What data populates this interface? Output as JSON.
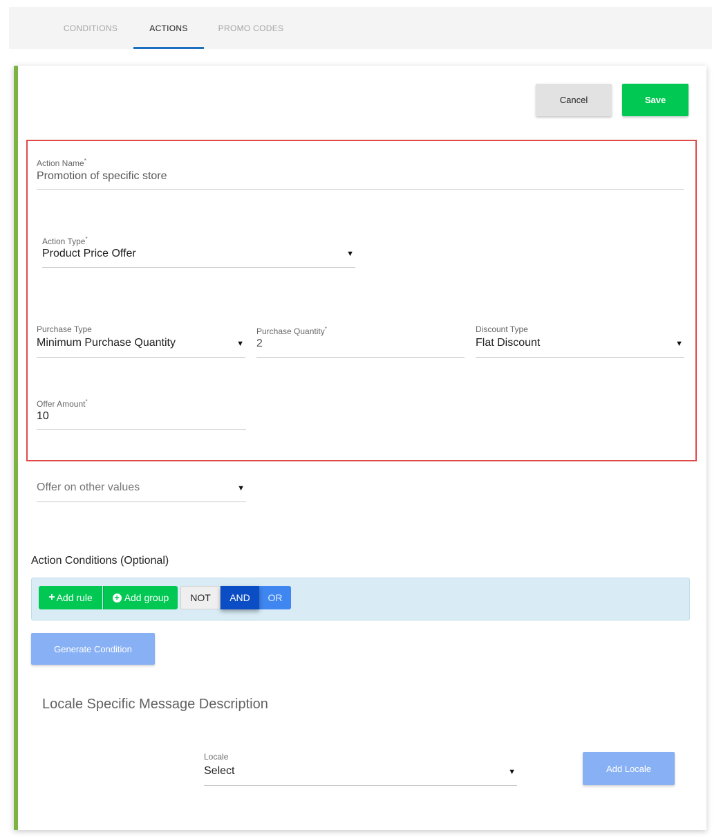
{
  "tabs": [
    {
      "label": "CONDITIONS",
      "active": false
    },
    {
      "label": "ACTIONS",
      "active": true
    },
    {
      "label": "PROMO CODES",
      "active": false
    }
  ],
  "toolbar": {
    "cancel_label": "Cancel",
    "save_label": "Save"
  },
  "form": {
    "action_name": {
      "label": "Action Name",
      "required": "*",
      "value": "Promotion of specific store"
    },
    "action_type": {
      "label": "Action Type",
      "required": "*",
      "value": "Product Price Offer"
    },
    "purchase_type": {
      "label": "Purchase Type",
      "value": "Minimum Purchase Quantity"
    },
    "purchase_quantity": {
      "label": "Purchase Quantity",
      "required": "*",
      "value": "2"
    },
    "discount_type": {
      "label": "Discount Type",
      "value": "Flat Discount"
    },
    "offer_amount": {
      "label": "Offer Amount",
      "required": "*",
      "value": "10"
    },
    "offer_other_values": {
      "placeholder": "Offer on other values"
    }
  },
  "action_conditions": {
    "title": "Action Conditions (Optional)",
    "add_rule_label": "Add rule",
    "add_group_label": "Add group",
    "not_label": "NOT",
    "and_label": "AND",
    "or_label": "OR",
    "active_operator": "AND",
    "generate_label": "Generate Condition"
  },
  "locale": {
    "title": "Locale Specific Message Description",
    "label": "Locale",
    "value": "Select",
    "add_label": "Add Locale"
  },
  "icons": {
    "dropdown": "caret-down-icon",
    "add_rule": "plus-icon",
    "add_group": "circle-plus-icon"
  },
  "colors": {
    "accent": "#7cb342",
    "save": "#00c853",
    "tab_underline": "#1e6fc2",
    "highlight": "#e04848",
    "and_active": "#0a4dc4",
    "disabled_button": "#88b0f5"
  }
}
